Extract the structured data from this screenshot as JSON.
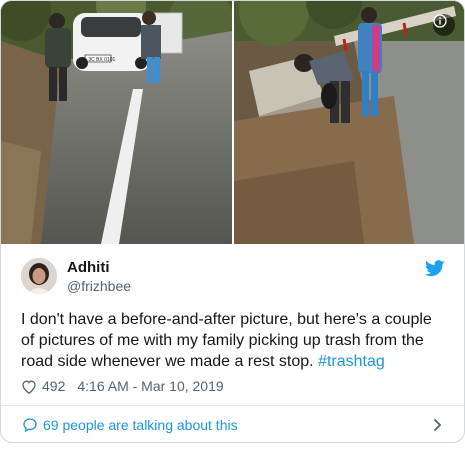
{
  "author": {
    "name": "Adhiti",
    "handle": "@frizhbee"
  },
  "tweet": {
    "text": "I don't have a before-and-after picture, but here's a couple of pictures of me with my family picking up trash from the road side whenever we made a rest stop. ",
    "hashtag": "#trashtag",
    "likes": "492",
    "timestamp": "4:16 AM - Mar 10, 2019"
  },
  "footer": {
    "talking_label": "69 people are talking about this"
  },
  "media": {
    "left_photo": "car-on-road-photo",
    "right_photo": "roadside-cleanup-photo",
    "plate_text": "DL 3C BX 0101"
  },
  "icons": {
    "info": "info-icon",
    "bird": "twitter-bird-icon",
    "heart": "heart-icon",
    "comment": "comment-icon",
    "chevron": "chevron-right-icon"
  },
  "colors": {
    "link": "#1b95e0",
    "twitter_blue": "#1da1f2",
    "secondary_text": "#536471",
    "border": "#cfd9de"
  }
}
